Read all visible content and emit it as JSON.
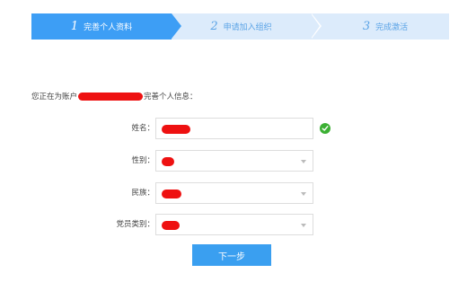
{
  "steps": [
    {
      "number": "1",
      "label": "完善个人资料",
      "state": "active"
    },
    {
      "number": "2",
      "label": "申请加入组织",
      "state": "pending"
    },
    {
      "number": "3",
      "label": "完成激活",
      "state": "pending"
    }
  ],
  "intro": {
    "prefix": "您正在为账户",
    "suffix": "完善个人信息："
  },
  "form": {
    "name": {
      "label": "姓名：",
      "validated": true
    },
    "gender": {
      "label": "性别："
    },
    "ethnicity": {
      "label": "民族："
    },
    "party": {
      "label": "党员类别："
    }
  },
  "next_button": "下一步",
  "colors": {
    "active_step": "#3d9ef5",
    "inactive_step": "#dcebfb",
    "button": "#3a9ff0",
    "success": "#3cb034",
    "redaction": "#ee1111"
  }
}
